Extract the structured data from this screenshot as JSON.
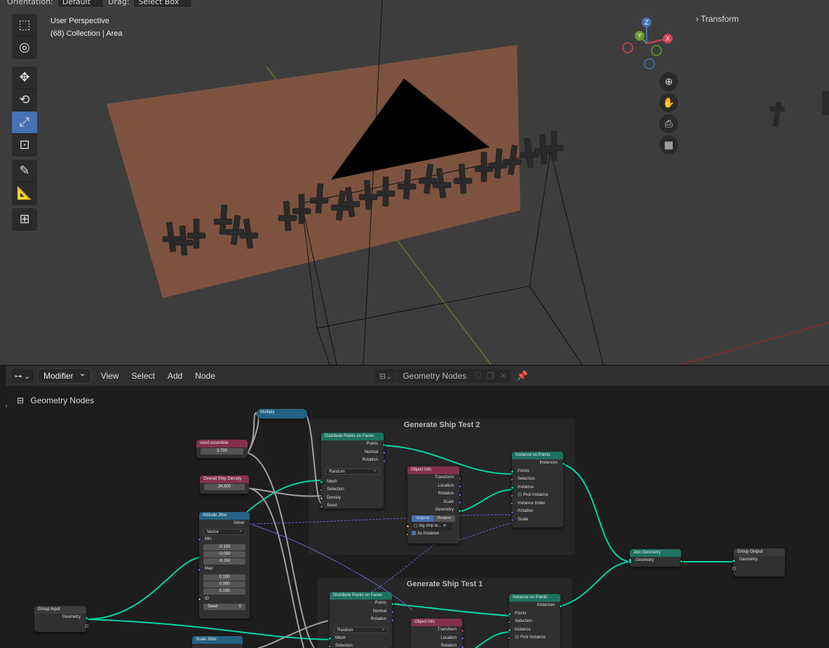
{
  "header": {
    "orientation_label": "Orientation:",
    "orientation_value": "Default",
    "drag_label": "Drag:",
    "drag_value": "Select Box"
  },
  "viewport": {
    "perspective": "User Perspective",
    "collection": "(68) Collection | Area",
    "transform_panel": "Transform",
    "gizmo": {
      "z": "Z",
      "y": "Y",
      "x": "X"
    },
    "tools": [
      "select-box-icon",
      "cursor-icon",
      "move-icon",
      "rotate-icon",
      "scale-icon",
      "transform-icon",
      "annotate-icon",
      "measure-icon",
      "add-cube-icon"
    ],
    "nav": [
      "zoom-icon",
      "pan-icon",
      "camera-icon",
      "grid-icon"
    ]
  },
  "editor": {
    "mode": "Modifier",
    "menu": [
      "View",
      "Select",
      "Add",
      "Node"
    ],
    "tree_name": "Geometry Nodes",
    "breadcrumb": "Geometry Nodes"
  },
  "frames": {
    "test2": "Generate Ship Test 2",
    "test1": "Generate Ship Test 1"
  },
  "nodes": {
    "multiply": {
      "title": "Multiply"
    },
    "seed_scrambler": {
      "title": "seed scrambler",
      "value": "3.700"
    },
    "ship_density": {
      "title": "Overall Ship Density",
      "value": "34.800"
    },
    "attitude_jitter": {
      "title": "Attitude Jitter",
      "output": "Value",
      "type": "Vector",
      "min_label": "Min",
      "min": [
        "-0.150",
        "-0.050",
        "-0.150"
      ],
      "max_label": "Max",
      "max": [
        "0.150",
        "0.050",
        "0.150"
      ],
      "id_label": "ID",
      "seed_label": "Seed",
      "seed_value": "0"
    },
    "distribute2": {
      "title": "Distribute Points on Faces",
      "outputs": [
        "Points",
        "Normal",
        "Rotation"
      ],
      "mode": "Random",
      "inputs": [
        "Mesh",
        "Selection",
        "Density",
        "Seed"
      ]
    },
    "object_info2": {
      "title": "Object Info",
      "outputs": [
        "Transform",
        "Location",
        "Rotation",
        "Scale",
        "Geometry"
      ],
      "toggle": [
        "Original",
        "Relative"
      ],
      "object": "big ship te...",
      "as_instance": "As Instance"
    },
    "instance_on_points2": {
      "title": "Instance on Points",
      "output": "Instances",
      "inputs": [
        "Points",
        "Selection",
        "Instance",
        "Pick Instance",
        "Instance Index",
        "Rotation",
        "Scale"
      ]
    },
    "join_geometry": {
      "title": "Join Geometry",
      "socket": "Geometry"
    },
    "group_output": {
      "title": "Group Output",
      "socket": "Geometry"
    },
    "group_input": {
      "title": "Group Input",
      "socket": "Geometry"
    },
    "distribute1": {
      "title": "Distribute Points on Faces",
      "outputs": [
        "Points",
        "Normal",
        "Rotation"
      ],
      "mode": "Random",
      "inputs": [
        "Mesh",
        "Selection"
      ]
    },
    "object_info1": {
      "title": "Object Info",
      "outputs": [
        "Transform",
        "Location",
        "Rotation"
      ]
    },
    "instance_on_points1": {
      "title": "Instance on Points",
      "output": "Instances",
      "inputs": [
        "Points",
        "Selection",
        "Instance",
        "Pick Instance"
      ]
    },
    "scale_jitter": {
      "title": "Scale Jitter"
    }
  },
  "colors": {
    "geometry_link": "#00d6a3",
    "vector_link": "#6363c7",
    "float_link": "#a1a1a1",
    "plane": "#7d5340",
    "active_tool": "#4772b3"
  }
}
